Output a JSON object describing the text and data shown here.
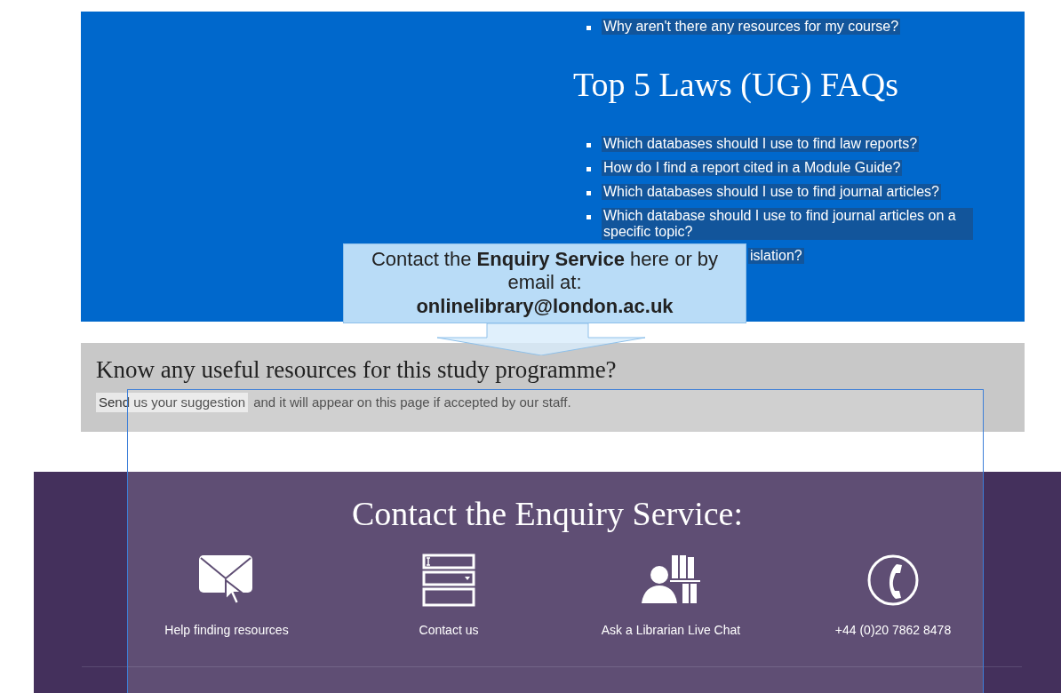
{
  "general_faq": {
    "items": [
      "Why aren't there any resources for my course?"
    ]
  },
  "laws_faq": {
    "heading": "Top 5 Laws (UG) FAQs",
    "items": [
      {
        "text": "Which databases should I use to find law reports?",
        "cut": false
      },
      {
        "text": "How do I find a report cited in a Module Guide?",
        "cut": false
      },
      {
        "text": "Which databases should I use to find journal articles?",
        "cut": false
      },
      {
        "text": "Which database should I use to find journal articles on a specific topic?",
        "cut": false
      },
      {
        "text": "islation?",
        "cut": true
      }
    ]
  },
  "suggest": {
    "heading": "Know any useful resources for this study programme?",
    "link": "Send us your suggestion",
    "text": "and it will appear on this page if accepted by our staff."
  },
  "contact": {
    "heading": "Contact the Enquiry Service:",
    "items": [
      {
        "kind": "email",
        "label": "Help finding resources"
      },
      {
        "kind": "form",
        "label": "Contact us"
      },
      {
        "kind": "librarian",
        "label": "Ask a Librarian Live Chat"
      },
      {
        "kind": "phone",
        "label": "+44 (0)20 7862 8478"
      }
    ]
  },
  "callout": {
    "text": "Contact the **Enquiry Service** here or by email at:",
    "email": "onlinelibrary@london.ac.uk"
  }
}
